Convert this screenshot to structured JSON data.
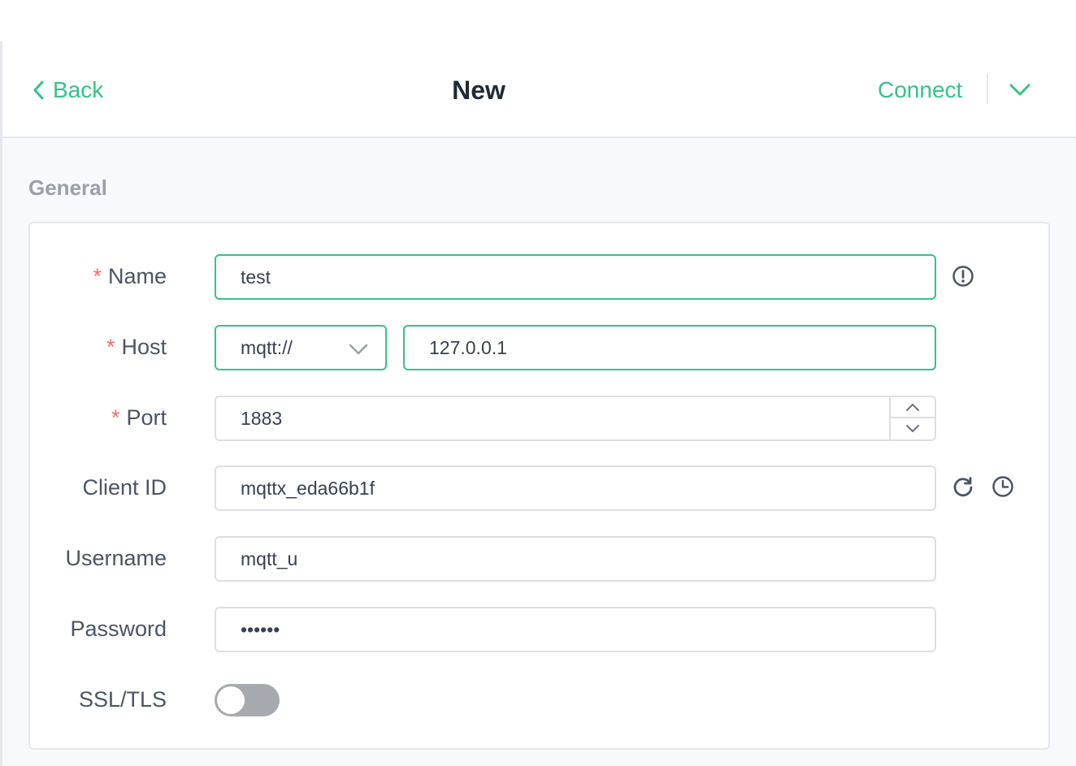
{
  "header": {
    "back_label": "Back",
    "title": "New",
    "connect_label": "Connect"
  },
  "section": {
    "title": "General"
  },
  "form": {
    "name": {
      "label": "Name",
      "required": true,
      "value": "test"
    },
    "host": {
      "label": "Host",
      "required": true,
      "protocol": "mqtt://",
      "value": "127.0.0.1"
    },
    "port": {
      "label": "Port",
      "required": true,
      "value": "1883"
    },
    "client_id": {
      "label": "Client ID",
      "value": "mqttx_eda66b1f"
    },
    "username": {
      "label": "Username",
      "value": "mqtt_u"
    },
    "password": {
      "label": "Password",
      "value": "••••••"
    },
    "ssl": {
      "label": "SSL/TLS",
      "enabled": false
    }
  },
  "icons": {
    "back": "chevron-left-icon",
    "more": "chevron-down-icon",
    "name_info": "exclamation-circle-icon",
    "refresh": "refresh-icon",
    "clock": "clock-icon"
  },
  "colors": {
    "accent": "#34c388",
    "required": "#f56c6c",
    "switch_off": "#a6a9ad"
  }
}
